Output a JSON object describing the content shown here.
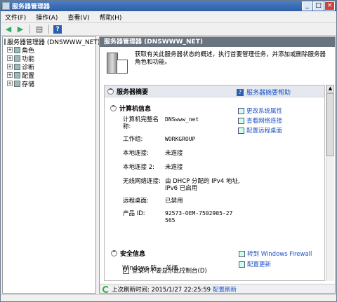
{
  "window": {
    "title": "服务器管理器",
    "min": "_",
    "max": "□",
    "close": "×"
  },
  "menu": [
    "文件(F)",
    "操作(A)",
    "查看(V)",
    "帮助(H)"
  ],
  "tree": {
    "root": "服务器管理器 (DNSWWW_NET)",
    "items": [
      "角色",
      "功能",
      "诊断",
      "配置",
      "存储"
    ]
  },
  "right": {
    "header": "服务器管理器 (DNSWWW_NET)",
    "intro": "获取有关此服务器状态的概述，执行首要管理任务，并添加或删除服务器角色和功能。",
    "summary_title": "服务器摘要",
    "summary_help": "服务器摘要帮助",
    "computer_info": {
      "title": "计算机信息",
      "rows": [
        {
          "k": "计算机完整名称:",
          "v": "DNSwww_net"
        },
        {
          "k": "工作组:",
          "v": "WORKGROUP"
        },
        {
          "k": "本地连接:",
          "v": "未连接"
        },
        {
          "k": "本地连接 2:",
          "v": "未连接"
        },
        {
          "k": "无线网络连接:",
          "v": "由 DHCP 分配的 IPv4 地址, IPv6 已启用"
        },
        {
          "k": "远程桌面:",
          "v": "已禁用"
        },
        {
          "k": "产品 ID:",
          "v": "92573-OEM-7502905-27565"
        }
      ],
      "actions": [
        "更改系统属性",
        "查看网络连接",
        "配置远程桌面"
      ],
      "checkbox": "登录时不要显示此控制台(D)"
    },
    "security": {
      "title": "安全信息",
      "row_k": "Windows 防",
      "row_v": "关闭",
      "actions": [
        "转到 Windows Firewall",
        "配置更新"
      ]
    },
    "status": {
      "label": "上次刷新时间: 2015/1/27 22:25:59",
      "link": "配置刷新"
    }
  }
}
